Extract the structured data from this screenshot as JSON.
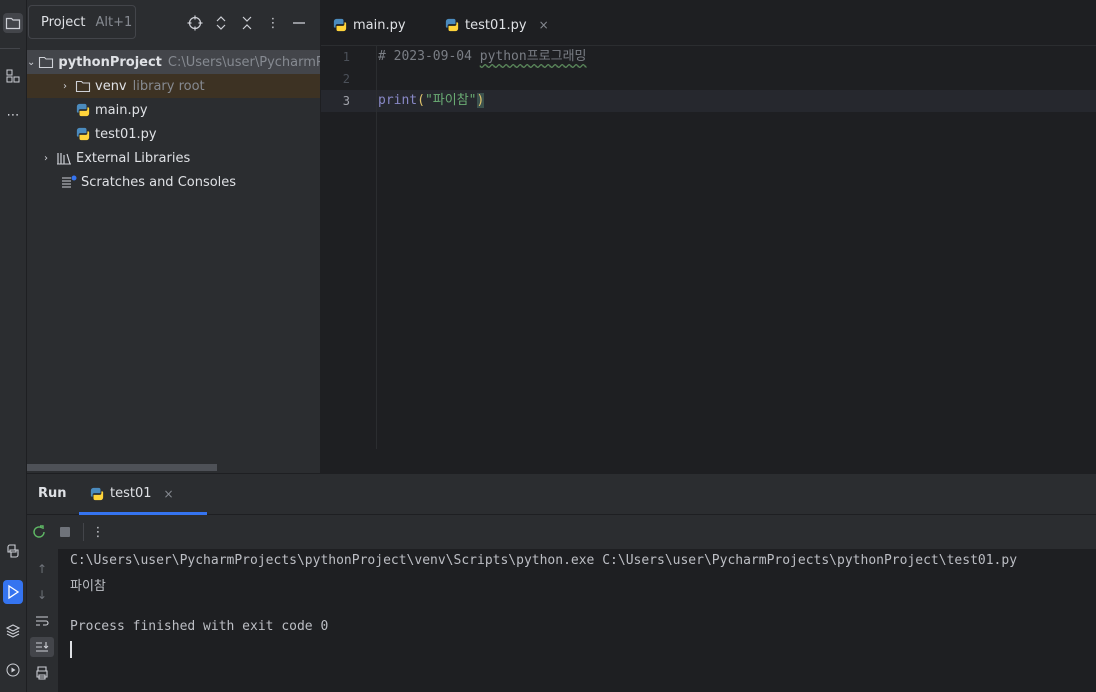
{
  "project_panel": {
    "title": "Project",
    "shortcut": "Alt+1",
    "tree": [
      {
        "label": "pythonProject",
        "hint": "C:\\Users\\user\\PycharmP"
      },
      {
        "label": "venv",
        "hint": "library root"
      },
      {
        "label": "main.py"
      },
      {
        "label": "test01.py"
      },
      {
        "label": "External Libraries"
      },
      {
        "label": "Scratches and Consoles"
      }
    ]
  },
  "editor": {
    "tabs": [
      {
        "label": "main.py"
      },
      {
        "label": "test01.py",
        "close": "×"
      }
    ],
    "line_numbers": [
      "1",
      "2",
      "3"
    ],
    "code": {
      "line1_comment_prefix": "# 2023-09-04 ",
      "line1_comment_word": "python프로그래밍",
      "line3_fn": "print",
      "line3_open": "(",
      "line3_str": "\"파이참\"",
      "line3_close": ")"
    }
  },
  "run_panel": {
    "label": "Run",
    "tab": "test01",
    "close": "×",
    "output": [
      "C:\\Users\\user\\PycharmProjects\\pythonProject\\venv\\Scripts\\python.exe C:\\Users\\user\\PycharmProjects\\pythonProject\\test01.py",
      "파이참",
      "",
      "Process finished with exit code 0"
    ]
  },
  "colors": {
    "accent": "#3574f0",
    "background": "#1e1f22",
    "panel": "#2b2d30"
  }
}
